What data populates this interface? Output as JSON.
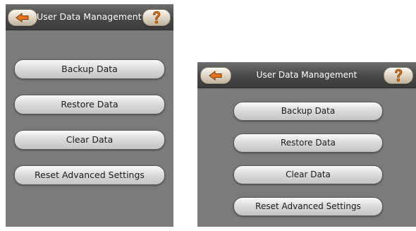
{
  "screens": [
    {
      "title": "User Data Management",
      "icons": {
        "back": "back-arrow-icon",
        "help": "question-mark-icon"
      },
      "buttons": [
        {
          "label": "Backup Data"
        },
        {
          "label": "Restore Data"
        },
        {
          "label": "Clear Data"
        },
        {
          "label": "Reset Advanced Settings"
        }
      ]
    },
    {
      "title": "User Data Management",
      "icons": {
        "back": "back-arrow-icon",
        "help": "question-mark-icon"
      },
      "buttons": [
        {
          "label": "Backup Data"
        },
        {
          "label": "Restore Data"
        },
        {
          "label": "Clear Data"
        },
        {
          "label": "Reset Advanced Settings"
        }
      ]
    }
  ],
  "colors": {
    "screen_bg": "#7b7b7b",
    "titlebar": "#474747",
    "arrow": "#e8741b",
    "help_mark": "#e0761a",
    "button_text": "#1c1c1c"
  }
}
